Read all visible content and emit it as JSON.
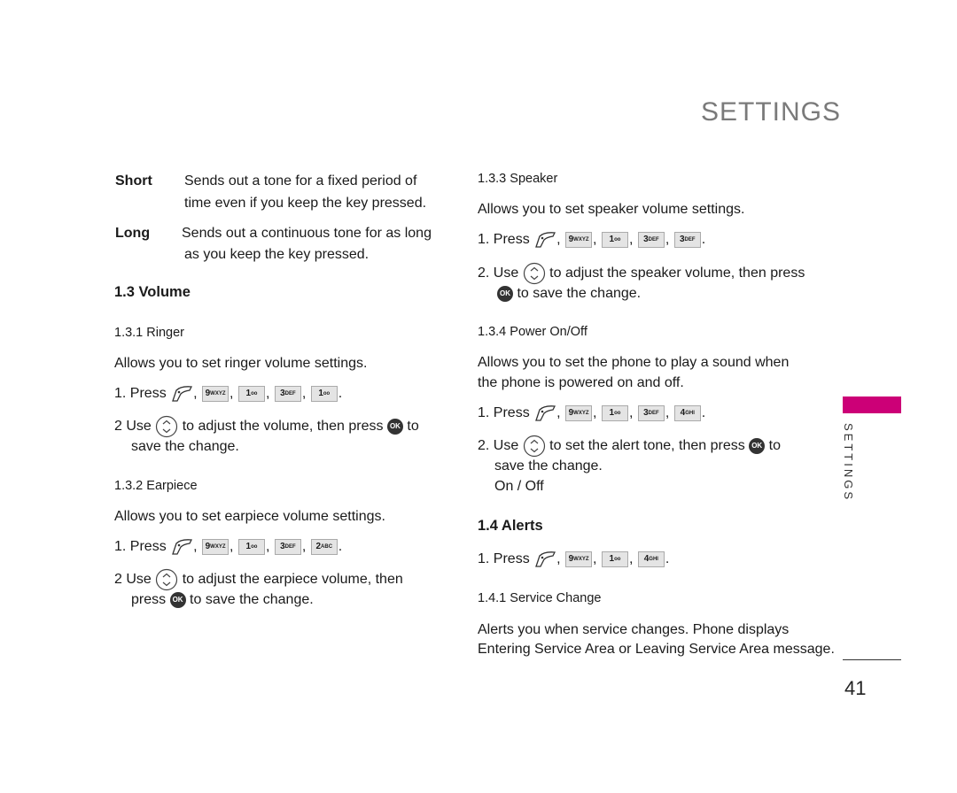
{
  "header": {
    "title": "SETTINGS"
  },
  "left": {
    "short_label": "Short",
    "short_desc_1": "Sends out a tone for a fixed period of",
    "short_desc_2": "time even if you keep the key pressed.",
    "long_label": "Long",
    "long_desc_1": "Sends out a continuous tone for as long",
    "long_desc_2": "as you keep the key pressed.",
    "volume_heading": "1.3 Volume",
    "ringer_heading": "1.3.1 Ringer",
    "ringer_desc": "Allows you to set ringer volume settings.",
    "ringer_step1_prefix": "1. Press",
    "ringer_step2_a": "2  Use",
    "ringer_step2_b": "to adjust the volume, then press",
    "ringer_step2_c": "to",
    "ringer_step2_d": "save the change.",
    "earpiece_heading": "1.3.2 Earpiece",
    "earpiece_desc": "Allows you to set earpiece volume settings.",
    "earpiece_step1_prefix": "1. Press",
    "earpiece_step2_a": "2  Use",
    "earpiece_step2_b": "to adjust the earpiece volume, then",
    "earpiece_step2_c": "press",
    "earpiece_step2_d": "to save the change."
  },
  "right": {
    "speaker_heading": "1.3.3 Speaker",
    "speaker_desc": "Allows you to set speaker volume settings.",
    "speaker_step1_prefix": "1. Press",
    "speaker_step2_a": "2. Use",
    "speaker_step2_b": "to adjust the speaker volume, then press",
    "speaker_step2_c": "to save the change.",
    "power_heading": "1.3.4 Power On/Off",
    "power_desc_1": "Allows you to set the phone to play a sound when",
    "power_desc_2": "the phone is powered on and off.",
    "power_step1_prefix": "1. Press",
    "power_step2_a": "2. Use",
    "power_step2_b": "to set the alert tone, then press",
    "power_step2_c": "to",
    "power_step2_d": "save the change.",
    "power_options": "On / Off",
    "alerts_heading": "1.4 Alerts",
    "alerts_step1_prefix": "1. Press",
    "service_heading": "1.4.1 Service Change",
    "service_desc_1": "Alerts you when service changes. Phone displays",
    "service_desc_2": "Entering Service Area or Leaving Service Area message."
  },
  "keys": {
    "k9": "9",
    "k9sub": "WXYZ",
    "k1": "1",
    "k1sub": "oo",
    "k3": "3",
    "k3sub": "DEF",
    "k2": "2",
    "k2sub": "ABC",
    "k4": "4",
    "k4sub": "GHI",
    "ok": "OK",
    "sep": ",",
    "end": "."
  },
  "sidebar": {
    "section_label": "SETTINGS",
    "accent_color": "#cc0077"
  },
  "footer": {
    "page_number": "41"
  }
}
